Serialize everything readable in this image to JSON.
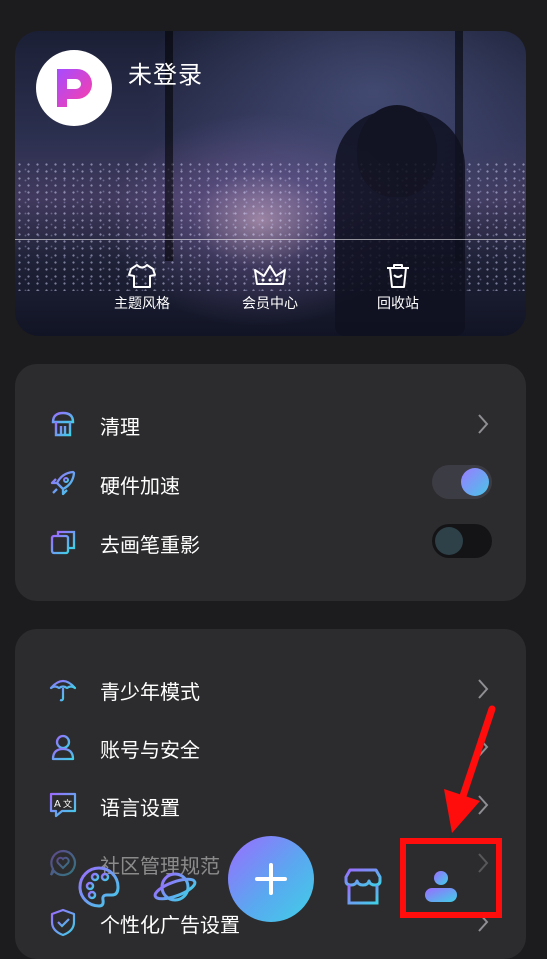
{
  "header": {
    "login_status": "未登录",
    "quick_actions": [
      {
        "label": "主题风格",
        "icon": "tshirt-icon"
      },
      {
        "label": "会员中心",
        "icon": "crown-icon"
      },
      {
        "label": "回收站",
        "icon": "recycle-bin-icon"
      }
    ]
  },
  "settings_group_1": {
    "items": [
      {
        "label": "清理",
        "icon": "cleaner-icon",
        "control": "chevron"
      },
      {
        "label": "硬件加速",
        "icon": "rocket-icon",
        "control": "toggle",
        "enabled": true
      },
      {
        "label": "去画笔重影",
        "icon": "layers-icon",
        "control": "toggle",
        "enabled": false
      }
    ]
  },
  "settings_group_2": {
    "items": [
      {
        "label": "青少年模式",
        "icon": "umbrella-icon",
        "control": "chevron"
      },
      {
        "label": "账号与安全",
        "icon": "user-outline-icon",
        "control": "chevron"
      },
      {
        "label": "语言设置",
        "icon": "translate-icon",
        "control": "chevron"
      },
      {
        "label": "社区管理规范",
        "icon": "heart-chat-icon",
        "control": "chevron"
      },
      {
        "label": "个性化广告设置",
        "icon": "shield-check-icon",
        "control": "chevron"
      }
    ]
  },
  "bottom_nav": {
    "items": [
      "palette-icon",
      "planet-icon",
      "add-icon",
      "shop-icon",
      "profile-icon"
    ],
    "active": "profile-icon"
  },
  "colors": {
    "background": "#1c1c1e",
    "card": "#2c2c2e",
    "accent_start": "#9b6bff",
    "accent_end": "#3fd0e6",
    "annotation": "#ff0d0d"
  }
}
